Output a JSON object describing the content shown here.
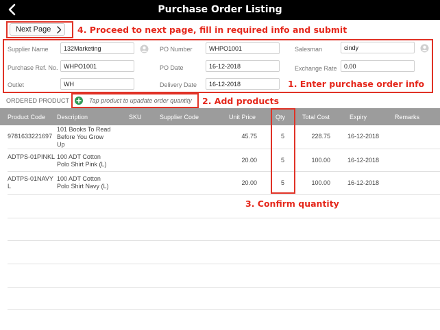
{
  "header": {
    "title": "Purchase Order Listing"
  },
  "toolbar": {
    "next_page_label": "Next Page"
  },
  "annotations": {
    "step1": "1. Enter purchase order info",
    "step2": "2. Add products",
    "step3": "3. Confirm quantity",
    "step4": "4. Proceed to next page, fill in required info and submit"
  },
  "form": {
    "supplier_name": {
      "label": "Supplier Name",
      "value": "132Marketing"
    },
    "po_number": {
      "label": "PO Number",
      "value": "WHPO1001"
    },
    "salesman": {
      "label": "Salesman",
      "value": "cindy"
    },
    "purchase_ref_no": {
      "label": "Purchase Ref. No.",
      "value": "WHPO1001"
    },
    "po_date": {
      "label": "PO Date",
      "value": "16-12-2018"
    },
    "exchange_rate": {
      "label": "Exchange Rate",
      "value": "0.00"
    },
    "outlet": {
      "label": "Outlet",
      "value": "WH"
    },
    "delivery_date": {
      "label": "Delivery Date",
      "value": "16-12-2018"
    }
  },
  "products": {
    "section_label": "ORDERED PRODUCT",
    "add_hint": "Tap product to upadate order quantity",
    "columns": {
      "product_code": "Product Code",
      "description": "Description",
      "sku": "SKU",
      "supplier_code": "Supplier Code",
      "unit_price": "Unit Price",
      "qty": "Qty",
      "total_cost": "Total Cost",
      "expiry": "Expiry",
      "remarks": "Remarks"
    },
    "rows": [
      {
        "product_code": "9781633221697",
        "description": "101 Books To Read Before You Grow Up",
        "unit_price": "45.75",
        "qty": "5",
        "total_cost": "228.75",
        "expiry": "16-12-2018"
      },
      {
        "product_code": "ADTPS-01PINKL",
        "description": "100 ADT Cotton Polo Shirt Pink (L)",
        "unit_price": "20.00",
        "qty": "5",
        "total_cost": "100.00",
        "expiry": "16-12-2018"
      },
      {
        "product_code": "ADTPS-01NAVY L",
        "description": "100 ADT Cotton Polo Shirt Navy (L)",
        "unit_price": "20.00",
        "qty": "5",
        "total_cost": "100.00",
        "expiry": "16-12-2018"
      }
    ]
  },
  "icons": {
    "back": "chevron-left-icon",
    "next": "chevron-right-icon",
    "supplier_lookup": "person-search-icon",
    "salesman_lookup": "person-search-icon",
    "add_product": "plus-circle-icon"
  },
  "colors": {
    "titlebar": "#000000",
    "annotation": "#e5281c",
    "table_header": "#9c9c9c",
    "add_button": "#2e9a55"
  }
}
